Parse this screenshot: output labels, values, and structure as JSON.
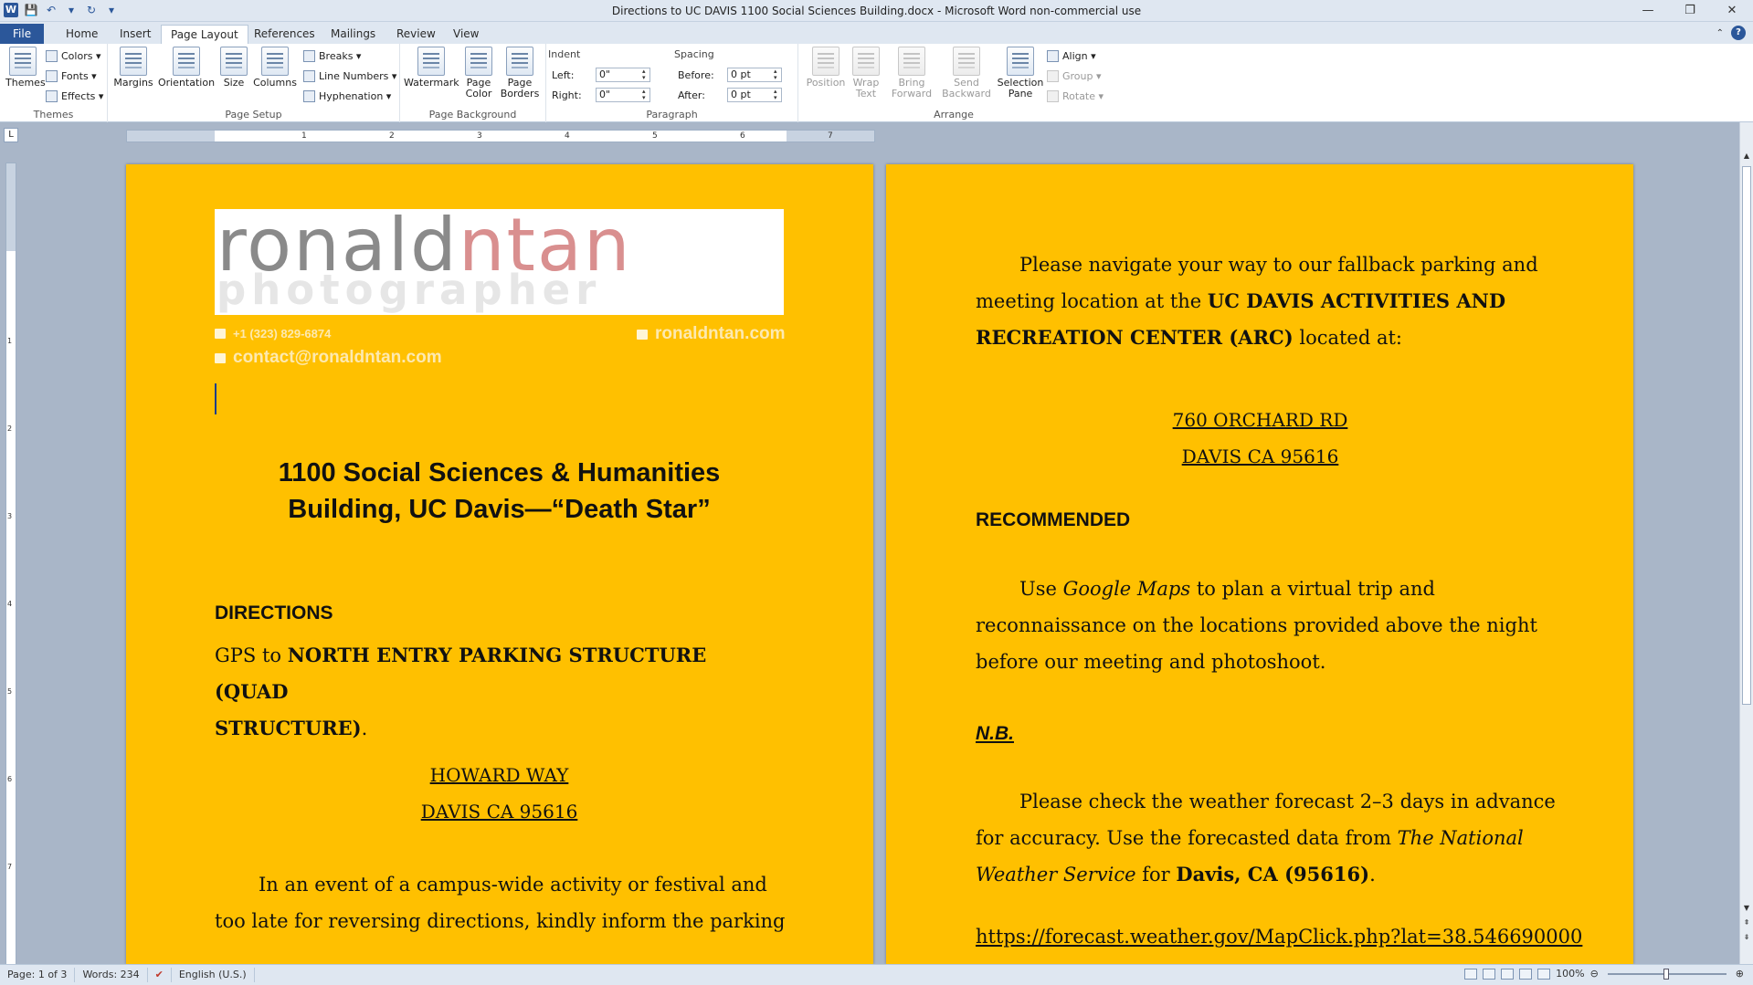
{
  "window": {
    "title": "Directions to UC DAVIS 1100 Social Sciences Building.docx - Microsoft Word non-commercial use",
    "controls": [
      "—",
      "❐",
      "✕"
    ]
  },
  "qat": {
    "logo": "W",
    "save": "💾",
    "undo": "↶",
    "undo_drop": "▾",
    "redo": "↻",
    "custom": "▾"
  },
  "tabs": [
    "File",
    "Home",
    "Insert",
    "Page Layout",
    "References",
    "Mailings",
    "Review",
    "View"
  ],
  "active_tab": "Page Layout",
  "help": {
    "minimize": "⌃",
    "icon": "?"
  },
  "ribbon": {
    "themes": {
      "label": "Themes",
      "themes_btn": "Themes",
      "colors": "Colors ▾",
      "fonts": "Fonts ▾",
      "effects": "Effects ▾"
    },
    "page_setup": {
      "label": "Page Setup",
      "margins": "Margins",
      "orientation": "Orientation",
      "size": "Size",
      "columns": "Columns",
      "breaks": "Breaks ▾",
      "line_numbers": "Line Numbers ▾",
      "hyphenation": "Hyphenation ▾"
    },
    "page_background": {
      "label": "Page Background",
      "watermark": "Watermark",
      "page_color": "Page Color",
      "page_borders": "Page Borders"
    },
    "paragraph": {
      "label": "Paragraph",
      "indent": "Indent",
      "left": "Left:",
      "left_val": "0\"",
      "right": "Right:",
      "right_val": "0\"",
      "spacing": "Spacing",
      "before": "Before:",
      "before_val": "0 pt",
      "after": "After:",
      "after_val": "0 pt"
    },
    "arrange": {
      "label": "Arrange",
      "position": "Position",
      "wrap_text": "Wrap Text",
      "bring_forward": "Bring Forward",
      "send_backward": "Send Backward",
      "selection_pane": "Selection Pane",
      "align": "Align ▾",
      "group": "Group ▾",
      "rotate": "Rotate ▾"
    }
  },
  "ruler": {
    "numbers": [
      "1",
      "2",
      "3",
      "4",
      "5",
      "6",
      "7"
    ],
    "vertical_numbers": [
      "1",
      "2",
      "3",
      "4",
      "5",
      "6",
      "7"
    ],
    "tab_selector": "L"
  },
  "page1": {
    "logo_name_1": "ronald",
    "logo_name_2": "ntan",
    "logo_sub": "photographer",
    "phone": "+1 (323) 829-6874",
    "website": "ronaldntan.com",
    "email": "contact@ronaldntan.com",
    "title_line1": "1100 Social Sciences & Humanities",
    "title_line2": "Building, UC Davis—“Death Star”",
    "directions_heading": "DIRECTIONS",
    "gps_prefix": "GPS to ",
    "gps_bold_line1": "NORTH ENTRY PARKING STRUCTURE (QUAD",
    "gps_bold_line2": "STRUCTURE)",
    "gps_suffix": ".",
    "addr_line1": "HOWARD WAY",
    "addr_line2": "DAVIS CA 95616",
    "event_line1": "In an event of a campus-wide activity or festival and",
    "event_line2": "too late for reversing directions, kindly inform the parking"
  },
  "page2": {
    "nav_line1": "Please navigate your way to our fallback parking and",
    "nav_line2_prefix": "meeting location at the ",
    "nav_line2_bold": "UC DAVIS ACTIVITIES AND",
    "nav_line3_bold": "RECREATION CENTER (ARC)",
    "nav_line3_suffix": " located at:",
    "addr_line1": "760 ORCHARD RD",
    "addr_line2": "DAVIS CA 95616",
    "recommended_heading": "RECOMMENDED",
    "use_prefix": "Use ",
    "use_italic": "Google Maps",
    "use_suffix": " to plan a virtual trip and",
    "recon_line": "reconnaissance on the locations provided above the night",
    "before_line": "before our meeting and photoshoot.",
    "nb_heading": "N.B.",
    "weather_line1": "Please check the weather forecast 2–3 days in advance",
    "weather_line2_prefix": "for accuracy. Use the forecasted data from ",
    "weather_line2_italic": "The National",
    "weather_line3_italic": "Weather Service",
    "weather_line3_mid": " for ",
    "weather_line3_bold": "Davis, CA (95616)",
    "weather_line3_suffix": ".",
    "url": "https://forecast.weather.gov/MapClick.php?lat=38.546690000"
  },
  "statusbar": {
    "page": "Page: 1 of 3",
    "words": "Words: 234",
    "spell_icon": "✔",
    "language": "English (U.S.)",
    "zoom": "100%",
    "zoom_minus": "⊖",
    "zoom_plus": "⊕"
  },
  "scrollbar": {
    "up": "▲",
    "down": "▼",
    "prev": "⇞",
    "next": "⇟"
  },
  "colors": {
    "page_bg": "#ffc000",
    "app_bg": "#a9b6c8",
    "file_tab": "#2b579a"
  }
}
